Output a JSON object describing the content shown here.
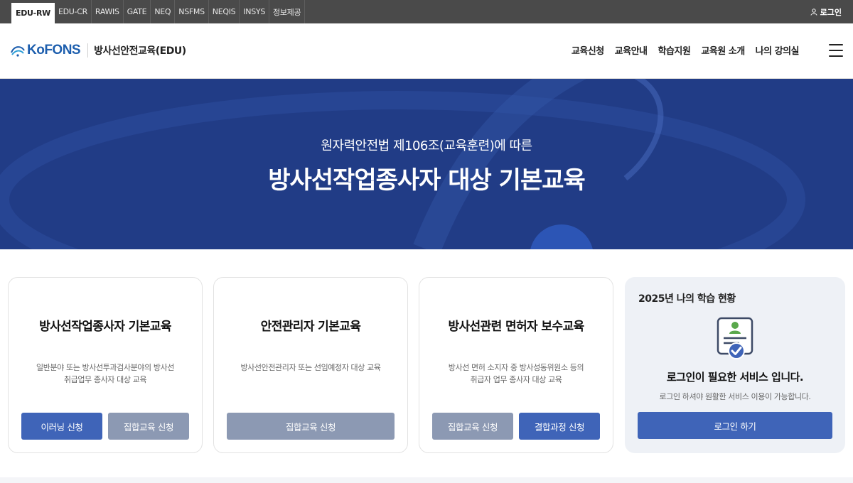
{
  "topbar": {
    "tabs": [
      "EDU-RW",
      "EDU-CR",
      "RAWIS",
      "GATE",
      "NEQ",
      "NSFMS",
      "NEQIS",
      "INSYS",
      "정보제공"
    ],
    "login_label": "로그인"
  },
  "header": {
    "logo_text": "KoFONS",
    "site_name": "방사선안전교육(EDU)",
    "nav": [
      "교육신청",
      "교육안내",
      "학습지원",
      "교육원 소개",
      "나의 강의실"
    ]
  },
  "hero": {
    "subtitle": "원자력안전법 제106조(교육훈련)에 따른",
    "title": "방사선작업종사자 대상 기본교육"
  },
  "cards": [
    {
      "title": "방사선작업종사자 기본교육",
      "desc_line1": "일반분야 또는 방사선투과검사분야의 방사선",
      "desc_line2": "취급업무 종사자 대상 교육",
      "btn1": "이러닝 신청",
      "btn2": "집합교육 신청"
    },
    {
      "title": "안전관리자 기본교육",
      "desc_line1": "방사선안전관리자 또는 선임예정자 대상 교육",
      "btn1": "집합교육 신청"
    },
    {
      "title": "방사선관련 면허자 보수교육",
      "desc_line1": "방사선 면허 소지자 중 방사성동위원소 등의",
      "desc_line2": "취급자 업무 종사자 대상 교육",
      "btn1": "집합교육 신청",
      "btn2": "결합과정 신청"
    }
  ],
  "status": {
    "title": "2025년 나의 학습 현황",
    "message": "로그인이 필요한 서비스 입니다.",
    "note": "로그인 하셔야 원활한 서비스 이용이 가능합니다.",
    "button": "로그인 하기"
  },
  "colors": {
    "hero_bg": "#213c86",
    "primary_button": "#3f64b8",
    "gray_button": "#8c99b3",
    "brand": "#1e5fae"
  },
  "icons": {
    "login": "user-icon",
    "menu": "hamburger-menu-icon",
    "status": "certificate-check-icon"
  }
}
